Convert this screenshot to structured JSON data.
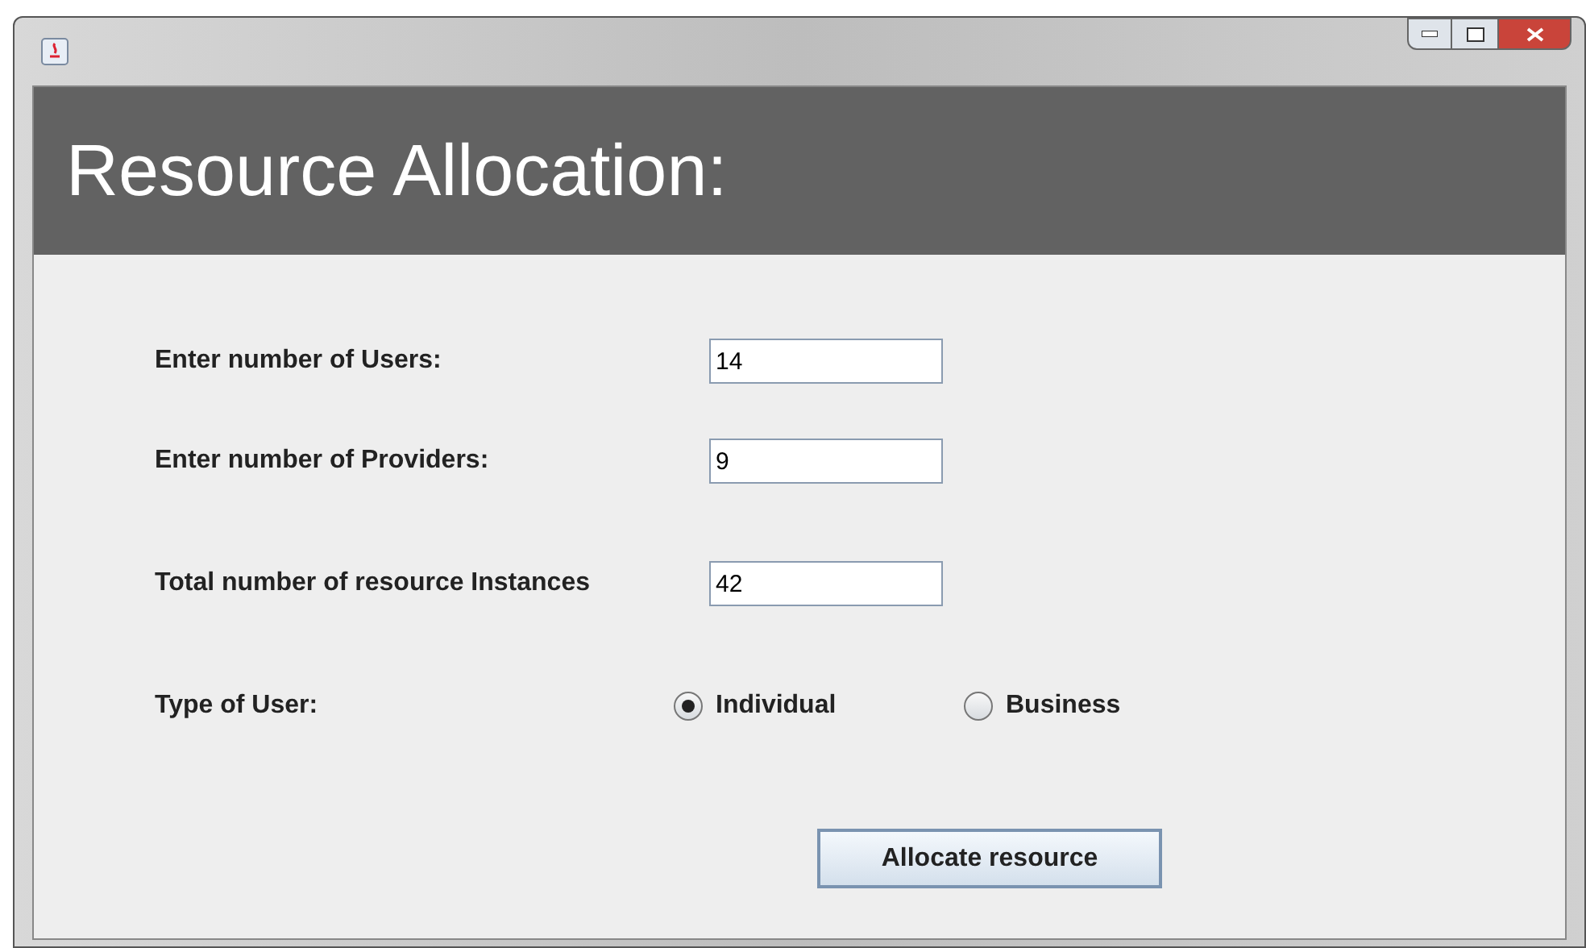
{
  "header": {
    "title": "Resource Allocation:"
  },
  "fields": [
    {
      "label": "Enter number of Users:",
      "value": "14"
    },
    {
      "label": "Enter number of Providers:",
      "value": "9"
    },
    {
      "label": "Total number of resource Instances",
      "value": "42"
    }
  ],
  "user_type": {
    "label": "Type of User:",
    "options": [
      {
        "label": "Individual",
        "selected": true
      },
      {
        "label": "Business",
        "selected": false
      }
    ]
  },
  "button": "Allocate resource"
}
